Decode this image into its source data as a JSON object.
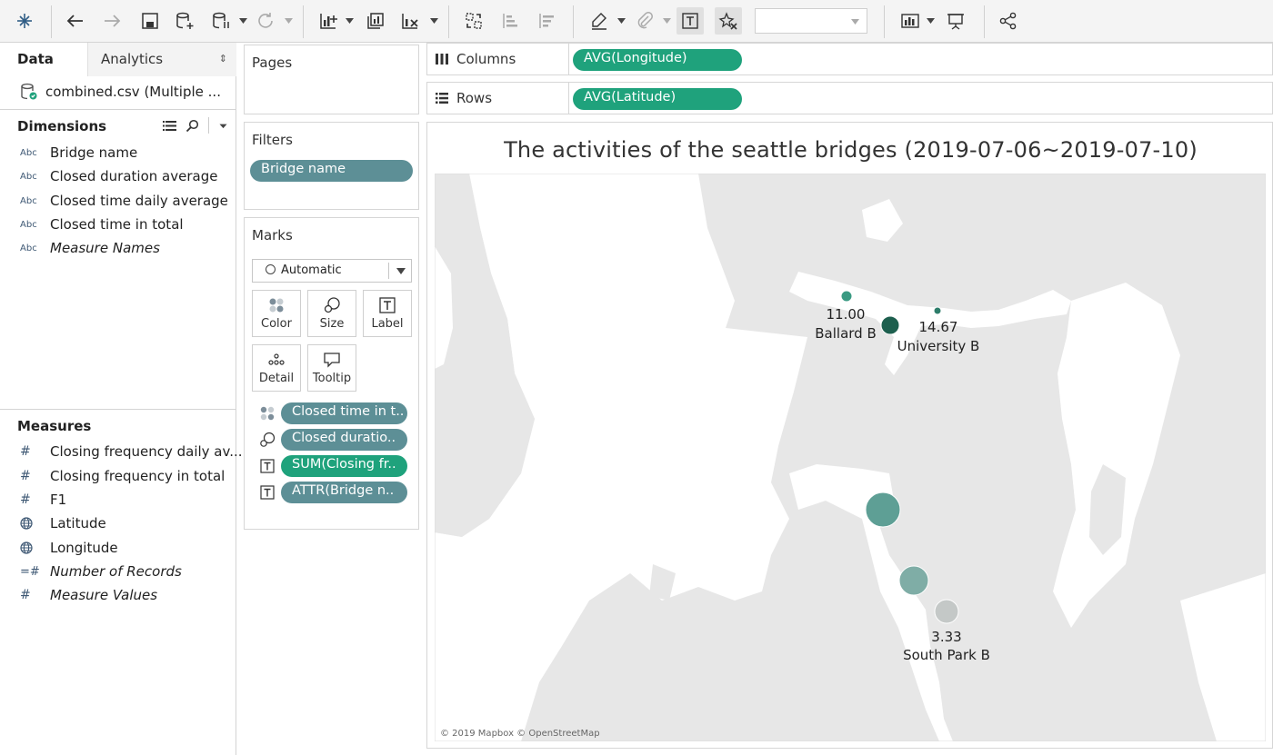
{
  "toolbar": {
    "icons": [
      "tableau-logo-icon",
      "undo-icon",
      "redo-icon",
      "save-icon",
      "new-datasource-icon",
      "pause-update-icon",
      "refresh-icon",
      "new-worksheet-icon",
      "duplicate-icon",
      "clear-sheet-icon",
      "swap-rows-columns-icon",
      "sort-ascending-icon",
      "sort-descending-icon",
      "highlight-icon",
      "group-members-icon",
      "show-mark-labels-icon",
      "fix-axes-icon",
      "fit-dropdown",
      "show-me-icon",
      "presentation-mode-icon",
      "share-icon"
    ]
  },
  "data_pane": {
    "tab_data": "Data",
    "tab_analytics": "Analytics",
    "analytics_arrows": "⇕",
    "datasource": "combined.csv (Multiple ...",
    "dimensions_header": "Dimensions",
    "dimensions": [
      {
        "type": "Abc",
        "label": "Bridge name",
        "italic": false
      },
      {
        "type": "Abc",
        "label": "Closed duration average",
        "italic": false
      },
      {
        "type": "Abc",
        "label": "Closed time daily average",
        "italic": false
      },
      {
        "type": "Abc",
        "label": "Closed time in total",
        "italic": false
      },
      {
        "type": "Abc",
        "label": "Measure Names",
        "italic": true
      }
    ],
    "measures_header": "Measures",
    "measures": [
      {
        "type": "#",
        "label": "Closing frequency daily av...",
        "italic": false
      },
      {
        "type": "#",
        "label": "Closing frequency in total",
        "italic": false
      },
      {
        "type": "#",
        "label": "F1",
        "italic": false
      },
      {
        "type": "globe",
        "label": "Latitude",
        "italic": false
      },
      {
        "type": "globe",
        "label": "Longitude",
        "italic": false
      },
      {
        "type": "=#",
        "label": "Number of Records",
        "italic": true
      },
      {
        "type": "#",
        "label": "Measure Values",
        "italic": true
      }
    ]
  },
  "pages": {
    "title": "Pages"
  },
  "filters": {
    "title": "Filters",
    "pills": [
      "Bridge name"
    ]
  },
  "marks": {
    "title": "Marks",
    "mark_type": "Automatic",
    "buttons": [
      "Color",
      "Size",
      "Label",
      "Detail",
      "Tooltip"
    ],
    "fields": [
      {
        "encoding": "color",
        "label": "Closed time in t..",
        "color": "#5d8f96"
      },
      {
        "encoding": "size",
        "label": "Closed duratio..",
        "color": "#5d8f96"
      },
      {
        "encoding": "label",
        "label": "SUM(Closing fr..",
        "color": "#1fa27c"
      },
      {
        "encoding": "label",
        "label": "ATTR(Bridge n..",
        "color": "#5d8f96"
      }
    ]
  },
  "columns": {
    "label": "Columns",
    "pill": "AVG(Longitude)"
  },
  "rows": {
    "label": "Rows",
    "pill": "AVG(Latitude)"
  },
  "viz": {
    "title": "The activities of the seattle bridges (2019-07-06~2019-07-10)",
    "attribution": "© 2019 Mapbox © OpenStreetMap",
    "bridges": [
      {
        "name": "Ballard B",
        "value": "11.00",
        "color": "#3a9a82"
      },
      {
        "name": "",
        "value": "",
        "color": "#1d5f4e"
      },
      {
        "name": "University B",
        "value": "14.67",
        "color": "#2d7d6a"
      },
      {
        "name": "",
        "value": "",
        "color": "#5e9f95"
      },
      {
        "name": "",
        "value": "",
        "color": "#7fada6"
      },
      {
        "name": "South Park B",
        "value": "3.33",
        "color": "#c4c8c7"
      }
    ]
  },
  "colors": {
    "accent_green": "#1fa27c",
    "pill_teal": "#5d8f96",
    "map_land": "#e6e6e6",
    "map_water": "#ffffff"
  }
}
